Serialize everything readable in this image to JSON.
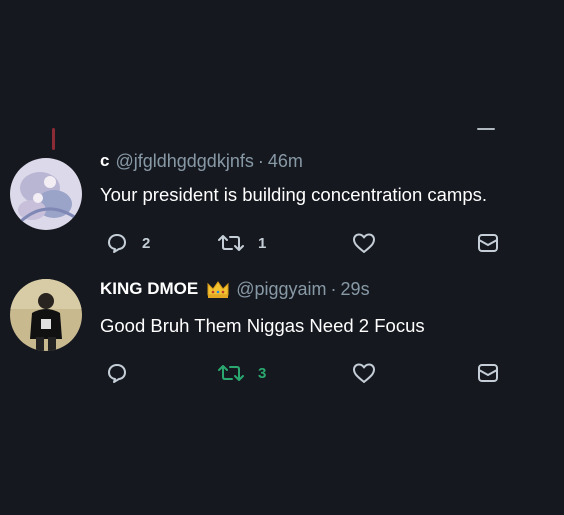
{
  "tweets": [
    {
      "display_name": "c",
      "handle": "@jfgldhgdgdkjnfs",
      "separator": "·",
      "time": "46m",
      "text": "Your president is building concentration camps.",
      "reply_count": "2",
      "retweet_count": "1",
      "retweeted": false
    },
    {
      "display_name": "KING DMOE",
      "badge_icon": "crown-icon",
      "handle": "@piggyaim",
      "separator": "·",
      "time": "29s",
      "text": "Good Bruh Them Niggas Need 2 Focus",
      "reply_count": "",
      "retweet_count": "3",
      "retweeted": true
    }
  ],
  "colors": {
    "background": "#15181f",
    "secondary_text": "#8899a6",
    "retweet_active": "#2aa86f",
    "thread_line": "#8b2b35"
  }
}
